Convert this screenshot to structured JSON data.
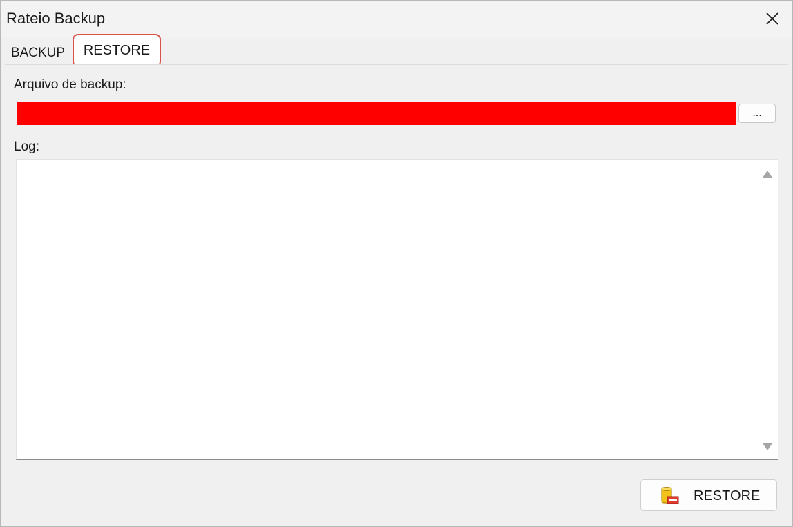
{
  "window": {
    "title": "Rateio Backup"
  },
  "tabs": [
    {
      "label": "BACKUP",
      "selected": false
    },
    {
      "label": "RESTORE",
      "selected": true
    }
  ],
  "restore_panel": {
    "file_label": "Arquivo de backup:",
    "file_value": "",
    "browse_label": "...",
    "log_label": "Log:",
    "log_text": "",
    "restore_button_label": "RESTORE"
  },
  "icons": {
    "close": "close-icon",
    "scroll_up": "triangle-up-icon",
    "scroll_down": "triangle-down-icon",
    "restore": "database-restore-icon"
  },
  "colors": {
    "file_field_background": "#ff0000",
    "selected_tab_highlight": "#d9534a"
  }
}
